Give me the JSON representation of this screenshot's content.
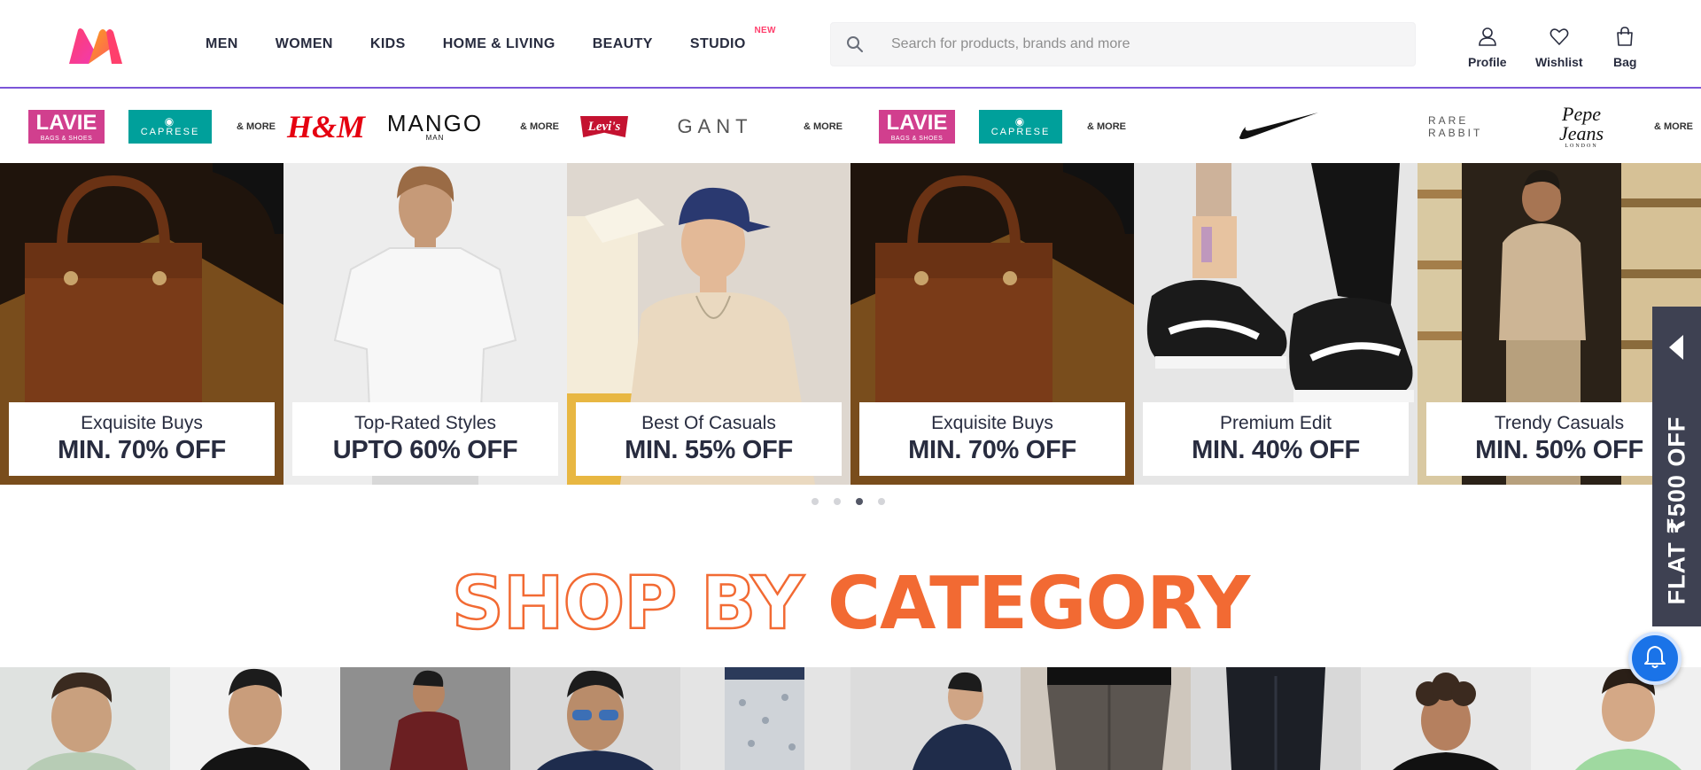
{
  "header": {
    "logo": "myntra-logo",
    "nav": [
      {
        "label": "MEN"
      },
      {
        "label": "WOMEN"
      },
      {
        "label": "KIDS"
      },
      {
        "label": "HOME & LIVING"
      },
      {
        "label": "BEAUTY"
      },
      {
        "label": "STUDIO",
        "badge": "NEW"
      }
    ],
    "search": {
      "placeholder": "Search for products, brands and more",
      "value": "",
      "icon": "search-icon"
    },
    "actions": [
      {
        "label": "Profile",
        "icon": "user-icon"
      },
      {
        "label": "Wishlist",
        "icon": "heart-icon"
      },
      {
        "label": "Bag",
        "icon": "bag-icon"
      }
    ],
    "accent_color": "#7b55d8"
  },
  "brand_strip": {
    "brands": [
      {
        "name": "LAVIE",
        "sub": "BAGS & SHOES"
      },
      {
        "name": "CAPRESE"
      },
      {
        "name": "& MORE"
      },
      {
        "name": "H&M"
      },
      {
        "name": "MANGO",
        "sub": "MAN"
      },
      {
        "name": "& MORE"
      },
      {
        "name": "Levi's"
      },
      {
        "name": "GANT"
      },
      {
        "name": "& MORE"
      },
      {
        "name": "LAVIE",
        "sub": "BAGS & SHOES"
      },
      {
        "name": "CAPRESE"
      },
      {
        "name": "& MORE"
      },
      {
        "name": "nike-swoosh-logo"
      },
      {
        "name": "RARE RABBIT"
      },
      {
        "name": "Pepe Jeans",
        "sub": "LONDON"
      },
      {
        "name": "& MORE"
      }
    ]
  },
  "promos": [
    {
      "title": "Exquisite Buys",
      "offer": "MIN. 70% OFF"
    },
    {
      "title": "Top-Rated Styles",
      "offer": "UPTO 60% OFF"
    },
    {
      "title": "Best Of Casuals",
      "offer": "MIN. 55% OFF"
    },
    {
      "title": "Exquisite Buys",
      "offer": "MIN. 70% OFF"
    },
    {
      "title": "Premium Edit",
      "offer": "MIN. 40% OFF"
    },
    {
      "title": "Trendy Casuals",
      "offer": "MIN. 50% OFF"
    }
  ],
  "carousel": {
    "total": 4,
    "active_index": 2
  },
  "section": {
    "outline_text": "SHOP BY",
    "fill_text": "CATEGORY",
    "color": "#f26a33"
  },
  "side_promo": {
    "text": "FLAT ₹500 OFF",
    "icon": "caret-left-icon"
  },
  "notification": {
    "icon": "bell-icon",
    "color": "#1a73e8"
  }
}
